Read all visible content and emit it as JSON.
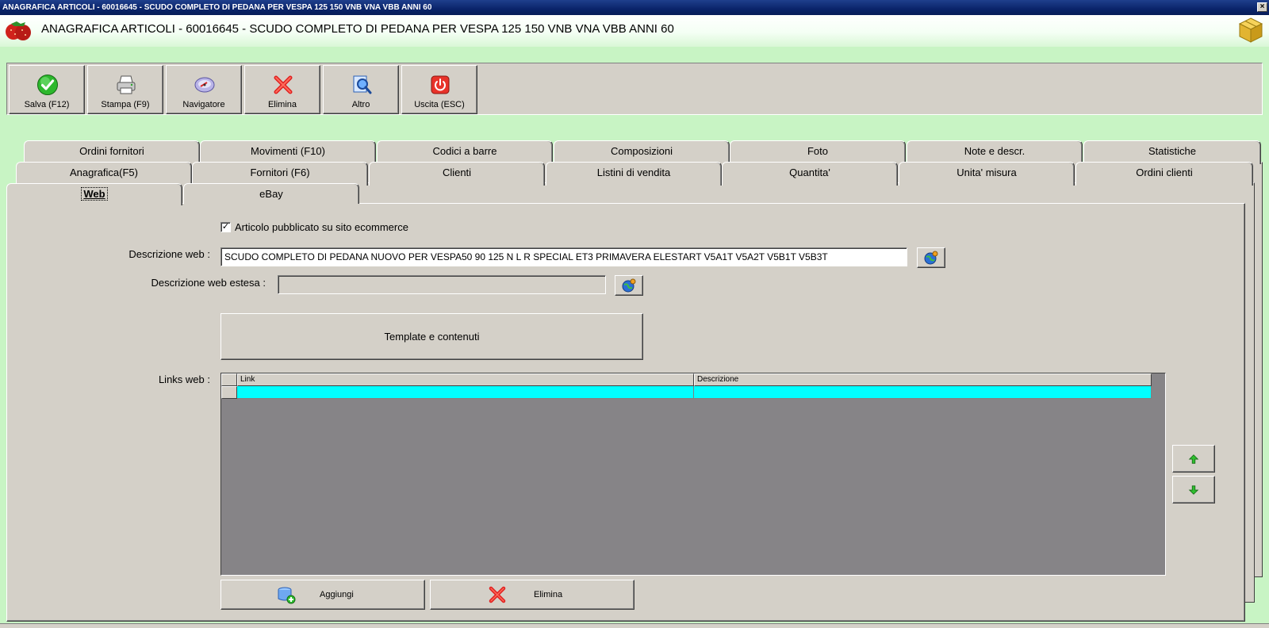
{
  "window": {
    "titlebar_text": "ANAGRAFICA ARTICOLI - 60016645 - SCUDO COMPLETO DI PEDANA PER VESPA 125 150 VNB VNA VBB ANNI 60",
    "close_glyph": "×",
    "header_title": "ANAGRAFICA ARTICOLI - 60016645 - SCUDO COMPLETO DI PEDANA PER VESPA 125 150 VNB VNA VBB ANNI 60"
  },
  "toolbar": {
    "buttons": [
      {
        "label": "Salva (F12)",
        "icon": "check-icon"
      },
      {
        "label": "Stampa (F9)",
        "icon": "printer-icon"
      },
      {
        "label": "Navigatore",
        "icon": "navigator-icon"
      },
      {
        "label": "Elimina",
        "icon": "delete-x-icon"
      },
      {
        "label": "Altro",
        "icon": "search-doc-icon"
      },
      {
        "label": "Uscita (ESC)",
        "icon": "power-icon"
      }
    ]
  },
  "tabs": {
    "row1": [
      "Ordini fornitori",
      "Movimenti (F10)",
      "Codici a barre",
      "Composizioni",
      "Foto",
      "Note e descr.",
      "Statistiche"
    ],
    "row2": [
      "Anagrafica(F5)",
      "Fornitori (F6)",
      "Clienti",
      "Listini di vendita",
      "Quantita'",
      "Unita' misura",
      "Ordini clienti"
    ],
    "row3": [
      "Web",
      "eBay"
    ],
    "active": "Web"
  },
  "web": {
    "published_label": "Articolo pubblicato su sito ecommerce",
    "published_checked": true,
    "check_glyph": "✓",
    "descr_label": "Descrizione web :",
    "descr_value": "SCUDO COMPLETO DI PEDANA NUOVO PER VESPA50 90 125 N L R SPECIAL ET3 PRIMAVERA  ELESTART V5A1T V5A2T V5B1T V5B3T",
    "descr_ext_label": "Descrizione web estesa :",
    "descr_ext_value": "",
    "template_button": "Template e contenuti",
    "links_label": "Links web :",
    "grid_columns": [
      "Link",
      "Descrizione"
    ],
    "add_button": "Aggiungi",
    "delete_button": "Elimina"
  },
  "colors": {
    "background": "#c8f4c4",
    "grid_selected_row": "#00ffff",
    "grid_empty": "#868487",
    "face": "#d4d0c8",
    "titlebar": "#0a246a"
  }
}
